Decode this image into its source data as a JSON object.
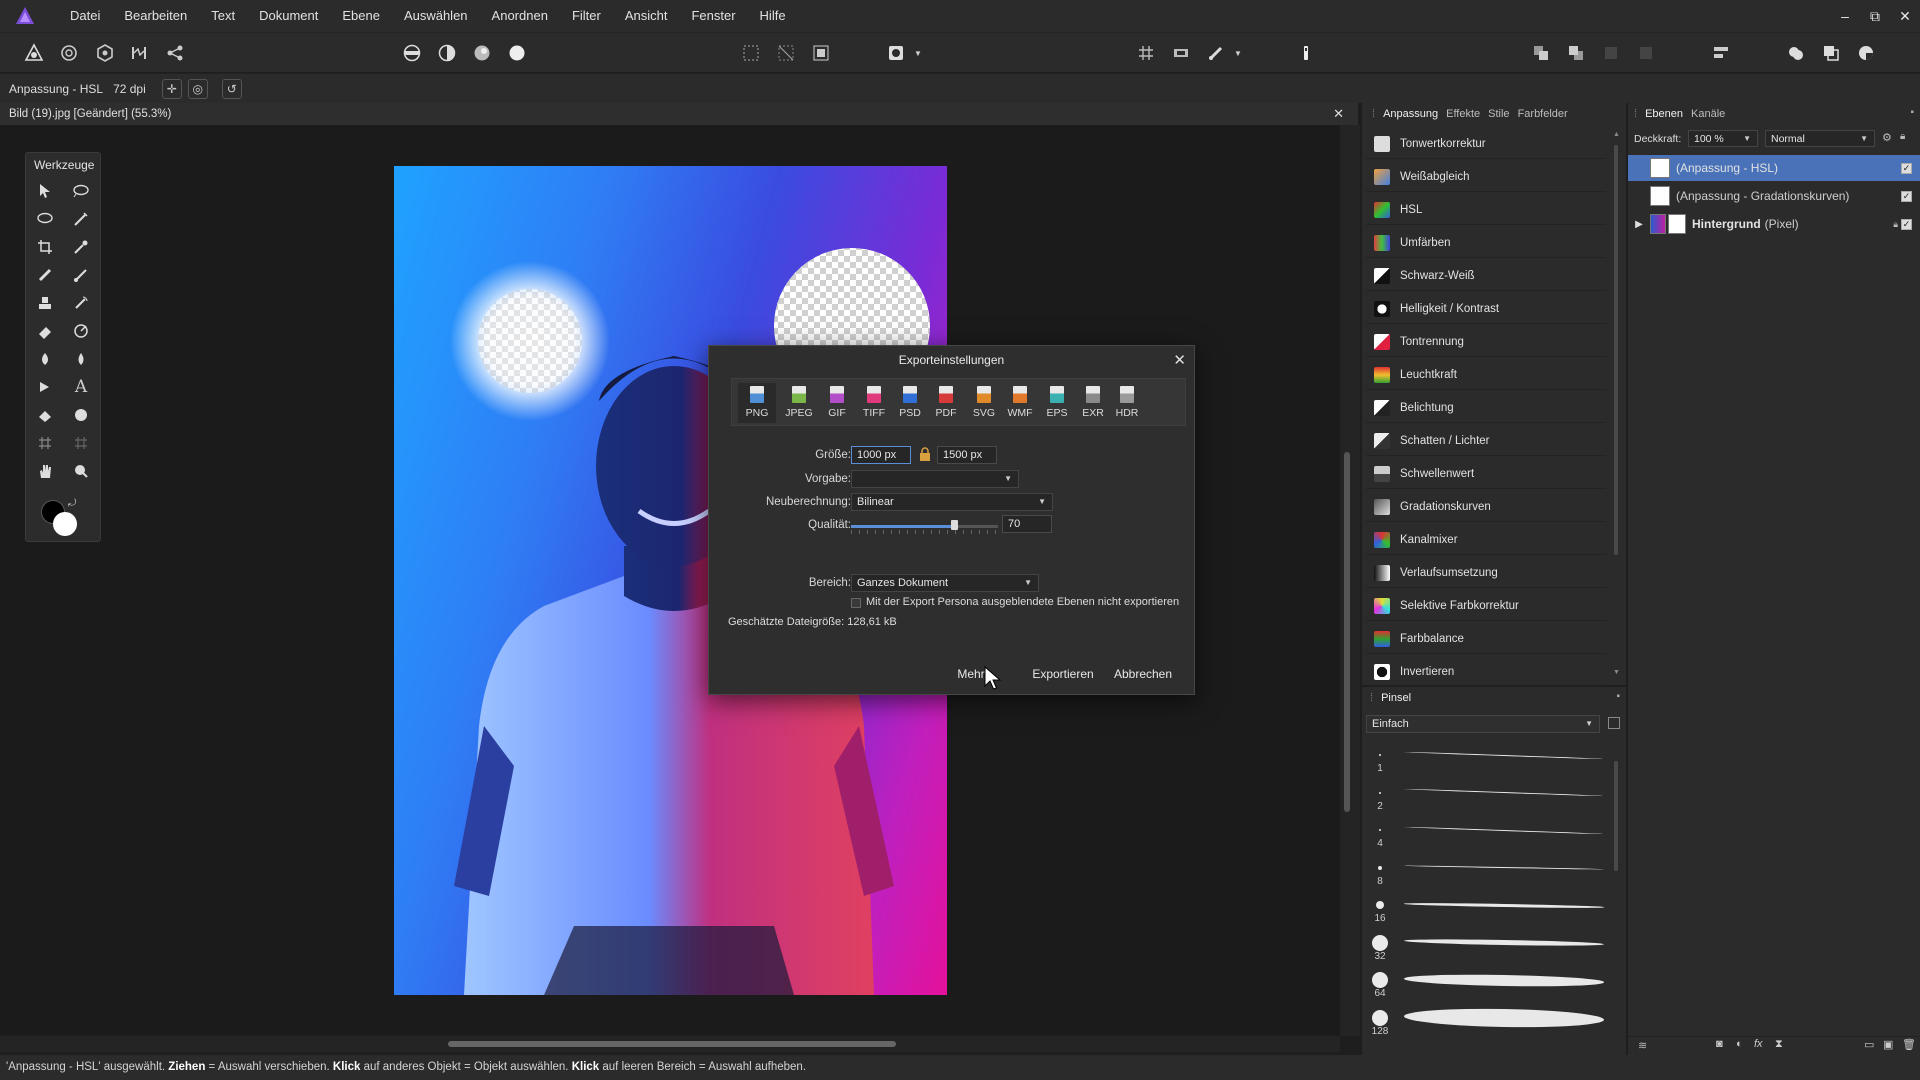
{
  "menubar": {
    "items": [
      "Datei",
      "Bearbeiten",
      "Text",
      "Dokument",
      "Ebene",
      "Auswählen",
      "Anordnen",
      "Filter",
      "Ansicht",
      "Fenster",
      "Hilfe"
    ],
    "window_controls": [
      "–",
      "⧉",
      "✕"
    ]
  },
  "context_bar": {
    "layer_name": "Anpassung - HSL",
    "dpi": "72 dpi"
  },
  "document_tab": {
    "title": "Bild (19).jpg [Geändert] (55.3%)",
    "close": "✕"
  },
  "tools_panel": {
    "title": "Werkzeuge"
  },
  "export_dialog": {
    "title": "Exporteinstellungen",
    "close": "✕",
    "formats": [
      {
        "label": "PNG",
        "color": "#4f8fd6",
        "selected": true
      },
      {
        "label": "JPEG",
        "color": "#7ab648",
        "selected": false
      },
      {
        "label": "GIF",
        "color": "#b24fc8",
        "selected": false
      },
      {
        "label": "TIFF",
        "color": "#e03a7c",
        "selected": false
      },
      {
        "label": "PSD",
        "color": "#2f6fd6",
        "selected": false
      },
      {
        "label": "PDF",
        "color": "#d63a3a",
        "selected": false
      },
      {
        "label": "SVG",
        "color": "#e08a2a",
        "selected": false
      },
      {
        "label": "WMF",
        "color": "#e07a2a",
        "selected": false
      },
      {
        "label": "EPS",
        "color": "#3ab0b0",
        "selected": false
      },
      {
        "label": "EXR",
        "color": "#8a8a8a",
        "selected": false
      },
      {
        "label": "HDR",
        "color": "#9a9a9a",
        "selected": false
      }
    ],
    "size_label": "Größe:",
    "width_value": "1000 px",
    "height_value": "1500 px",
    "preset_label": "Vorgabe:",
    "preset_value": "",
    "resample_label": "Neuberechnung:",
    "resample_value": "Bilinear",
    "quality_label": "Qualität:",
    "quality_value": "70",
    "quality_fraction": 0.7,
    "area_label": "Bereich:",
    "area_value": "Ganzes Dokument",
    "hidden_layers_checkbox": "Mit der Export Persona ausgeblendete Ebenen nicht exportieren",
    "filesize_label": "Geschätzte Dateigröße:",
    "filesize_value": "128,61 kB",
    "more_button": "Mehr",
    "export_button": "Exportieren",
    "cancel_button": "Abbrechen"
  },
  "adjustment_panel": {
    "tabs": [
      "Anpassung",
      "Effekte",
      "Stile",
      "Farbfelder"
    ],
    "items": [
      {
        "label": "Tonwertkorrektur",
        "icon": "levels-icon"
      },
      {
        "label": "Weißabgleich",
        "icon": "white-balance-icon"
      },
      {
        "label": "HSL",
        "icon": "hsl-icon"
      },
      {
        "label": "Umfärben",
        "icon": "recolor-icon"
      },
      {
        "label": "Schwarz-Weiß",
        "icon": "black-white-icon"
      },
      {
        "label": "Helligkeit / Kontrast",
        "icon": "brightness-contrast-icon"
      },
      {
        "label": "Tontrennung",
        "icon": "posterize-icon"
      },
      {
        "label": "Leuchtkraft",
        "icon": "vibrance-icon"
      },
      {
        "label": "Belichtung",
        "icon": "exposure-icon"
      },
      {
        "label": "Schatten / Lichter",
        "icon": "shadows-highlights-icon"
      },
      {
        "label": "Schwellenwert",
        "icon": "threshold-icon"
      },
      {
        "label": "Gradationskurven",
        "icon": "curves-icon"
      },
      {
        "label": "Kanalmixer",
        "icon": "channel-mixer-icon"
      },
      {
        "label": "Verlaufsumsetzung",
        "icon": "gradient-map-icon"
      },
      {
        "label": "Selektive Farbkorrektur",
        "icon": "selective-color-icon"
      },
      {
        "label": "Farbbalance",
        "icon": "color-balance-icon"
      },
      {
        "label": "Invertieren",
        "icon": "invert-icon"
      }
    ]
  },
  "brush_panel": {
    "tab": "Pinsel",
    "category": "Einfach",
    "sizes": [
      "1",
      "2",
      "4",
      "8",
      "16",
      "32",
      "64",
      "128"
    ]
  },
  "layers_panel": {
    "tabs": [
      "Ebenen",
      "Kanäle"
    ],
    "opacity_label": "Deckkraft:",
    "opacity_value": "100 %",
    "blend_mode": "Normal",
    "layers": [
      {
        "name": "(Anpassung - HSL)",
        "selected": true
      },
      {
        "name": "(Anpassung - Gradationskurven)",
        "selected": false
      },
      {
        "name": "Hintergrund",
        "suffix": "(Pixel)",
        "selected": false
      }
    ]
  },
  "status_bar": {
    "p1": "'Anpassung - HSL' ausgewählt. ",
    "b1": "Ziehen",
    "p2": " = Auswahl verschieben. ",
    "b2": "Klick",
    "p3": " auf anderes Objekt = Objekt auswählen. ",
    "b3": "Klick",
    "p4": " auf leeren Bereich = Auswahl aufheben."
  },
  "colors": {
    "accent": "#4a72b8",
    "panel_bg": "#2b2b2b",
    "canvas_bg": "#1b1b1b"
  }
}
